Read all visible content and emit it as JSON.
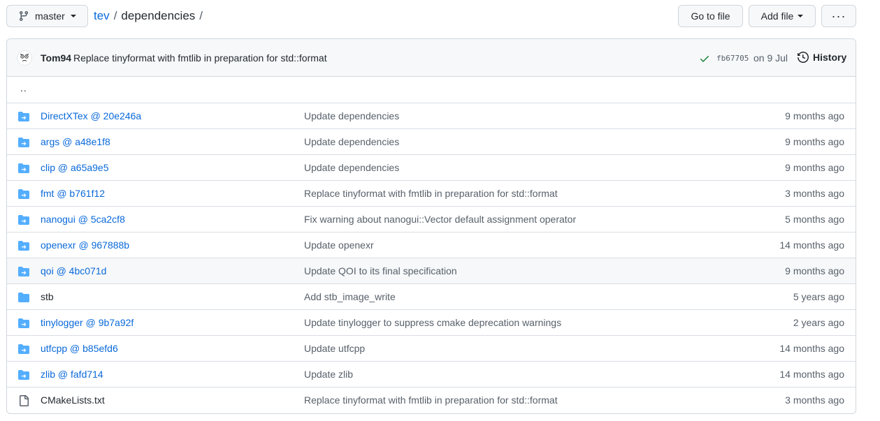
{
  "header": {
    "branch": "master",
    "breadcrumb": {
      "repo": "tev",
      "sep1": "/",
      "folder": "dependencies",
      "sep2": "/"
    },
    "go_to_file": "Go to file",
    "add_file": "Add file",
    "more": "···"
  },
  "commit": {
    "author": "Tom94",
    "message": "Replace tinyformat with fmtlib in preparation for std::format",
    "sha": "fb67705",
    "date": "on 9 Jul",
    "history": "History",
    "status_color": "#1a7f37"
  },
  "parent": "..",
  "files": [
    {
      "name": "DirectXTex @ 20e246a",
      "type": "submodule",
      "message": "Update dependencies",
      "age": "9 months ago"
    },
    {
      "name": "args @ a48e1f8",
      "type": "submodule",
      "message": "Update dependencies",
      "age": "9 months ago"
    },
    {
      "name": "clip @ a65a9e5",
      "type": "submodule",
      "message": "Update dependencies",
      "age": "9 months ago"
    },
    {
      "name": "fmt @ b761f12",
      "type": "submodule",
      "message": "Replace tinyformat with fmtlib in preparation for std::format",
      "age": "3 months ago"
    },
    {
      "name": "nanogui @ 5ca2cf8",
      "type": "submodule",
      "message": "Fix warning about nanogui::Vector default assignment operator",
      "age": "5 months ago"
    },
    {
      "name": "openexr @ 967888b",
      "type": "submodule",
      "message": "Update openexr",
      "age": "14 months ago"
    },
    {
      "name": "qoi @ 4bc071d",
      "type": "submodule",
      "message": "Update QOI to its final specification",
      "age": "9 months ago",
      "hover": true
    },
    {
      "name": "stb",
      "type": "directory",
      "message": "Add stb_image_write",
      "age": "5 years ago"
    },
    {
      "name": "tinylogger @ 9b7a92f",
      "type": "submodule",
      "message": "Update tinylogger to suppress cmake deprecation warnings",
      "age": "2 years ago"
    },
    {
      "name": "utfcpp @ b85efd6",
      "type": "submodule",
      "message": "Update utfcpp",
      "age": "14 months ago"
    },
    {
      "name": "zlib @ fafd714",
      "type": "submodule",
      "message": "Update zlib",
      "age": "14 months ago"
    },
    {
      "name": "CMakeLists.txt",
      "type": "file",
      "message": "Replace tinyformat with fmtlib in preparation for std::format",
      "age": "3 months ago"
    }
  ],
  "colors": {
    "folder": "#54aeff",
    "link": "#0969da",
    "muted": "#57606a",
    "border": "#d0d7de"
  }
}
